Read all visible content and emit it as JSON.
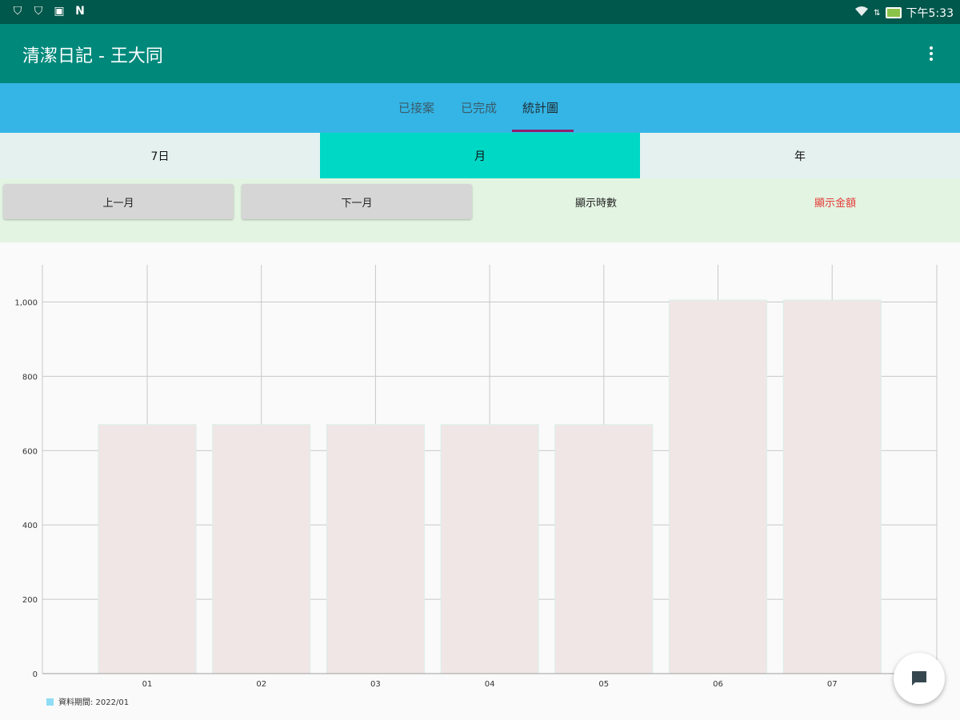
{
  "status_bar": {
    "icons": [
      "shield-icon",
      "shield-icon",
      "image-icon",
      "n-icon"
    ],
    "right_icons": [
      "wifi-icon",
      "signal-icon",
      "battery-charging-icon"
    ],
    "time": "下午5:33"
  },
  "app_bar": {
    "title": "清潔日記 - 王大同",
    "menu_icon": "more-vert-icon"
  },
  "tabs": [
    {
      "label": "已接案",
      "active": false
    },
    {
      "label": "已完成",
      "active": false
    },
    {
      "label": "統計圖",
      "active": true
    }
  ],
  "periods": [
    {
      "label": "7日",
      "selected": false
    },
    {
      "label": "月",
      "selected": true
    },
    {
      "label": "年",
      "selected": false
    }
  ],
  "controls": {
    "prev_label": "上一月",
    "next_label": "下一月",
    "show_hours_label": "顯示時數",
    "show_amount_label": "顯示金額"
  },
  "colors": {
    "status_bar": "#00574b",
    "app_bar": "#00897b",
    "tab_bar": "#34b5e5",
    "period_selected": "#00d8c6",
    "bar_fill": "#f0e6e5",
    "amount_text": "#e53935",
    "legend_swatch": "#8fdcf5"
  },
  "chart_data": {
    "type": "bar",
    "categories": [
      "01",
      "02",
      "03",
      "04",
      "05",
      "06",
      "07"
    ],
    "values": [
      670,
      670,
      670,
      670,
      670,
      1005,
      1005
    ],
    "ylim": [
      0,
      1100
    ],
    "yticks": [
      0,
      200,
      400,
      600,
      800,
      1000
    ],
    "ytick_labels": [
      "0",
      "200",
      "400",
      "600",
      "800",
      "1,000"
    ],
    "legend": "資料期間: 2022/01",
    "grid": true
  },
  "fab_icon": "chat-icon"
}
